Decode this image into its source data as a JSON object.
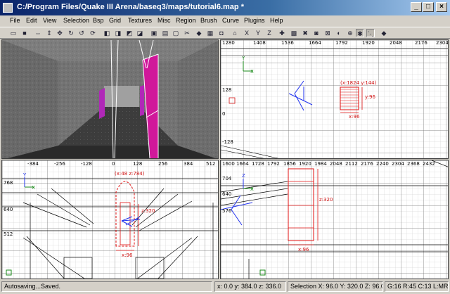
{
  "window": {
    "title": "C:/Program Files/Quake III Arena/baseq3/maps/tutorial6.map *",
    "minimize": "_",
    "maximize": "□",
    "close": "×"
  },
  "menu": [
    "File",
    "Edit",
    "View",
    "Selection",
    "Bsp",
    "Grid",
    "Textures",
    "Misc",
    "Region",
    "Brush",
    "Curve",
    "Plugins",
    "Help"
  ],
  "toolbar": {
    "icons": [
      "open-icon",
      "save-icon",
      "flip-x-icon",
      "flip-y-icon",
      "flip-z-icon",
      "rotate-x-icon",
      "rotate-y-icon",
      "rotate-z-icon",
      "select-complete-icon",
      "select-touching-icon",
      "select-partial-icon",
      "select-inside-icon",
      "csg-subtract-icon",
      "csg-merge-icon",
      "hollow-icon",
      "clipper-icon",
      "change-view-icon",
      "texture-view-icon",
      "camera-icon",
      "cubic-clip-icon",
      "view-x-icon",
      "view-y-icon",
      "view-z-icon",
      "entity-icon",
      "patch-icon",
      "bend-icon",
      "cap-icon",
      "weld-icon",
      "thicken-icon",
      "drill-icon",
      "show-angle-icon",
      "vertex-icon",
      "region-icon"
    ],
    "view_x_label": "X",
    "view_y_label": "Y",
    "view_z_label": "Z"
  },
  "views": {
    "top_right": {
      "top_ruler": [
        "1280",
        "1408",
        "1536",
        "1664",
        "1792",
        "1920",
        "2048",
        "2176",
        "2304"
      ],
      "left_ruler": [
        "128",
        "0",
        "-128"
      ],
      "axis_x": "X",
      "axis_y": "Y",
      "selection_coords": "(x:1824  y:144)",
      "size_y": "y:96",
      "size_x": "x:96"
    },
    "bottom_left": {
      "top_ruler": [
        "-384",
        "-256",
        "-128",
        "0",
        "128",
        "256",
        "384",
        "512"
      ],
      "left_ruler": [
        "768",
        "640",
        "512"
      ],
      "axis_x": "X",
      "axis_y": "Y",
      "selection_coords": "(x:48  z:784)",
      "size_z": "z:320",
      "size_x": "x:96"
    },
    "bottom_right": {
      "top_ruler": [
        "1600",
        "1664",
        "1728",
        "1792",
        "1856",
        "1920",
        "1984",
        "2048",
        "2112",
        "2176",
        "2240",
        "2304",
        "2368",
        "2432"
      ],
      "left_ruler": [
        "704",
        "640",
        "576"
      ],
      "axis_x": "X",
      "axis_y": "Z",
      "size_z": "z:320",
      "size_x": "x:96"
    }
  },
  "status": {
    "message": "Autosaving...Saved.",
    "position": "x:  0.0  y: 384.0  z: 336.0",
    "selection": "Selection X:  96.0  Y:  320.0  Z:  96.0",
    "grid": "G:16 R:45 C:13 L:MR"
  }
}
